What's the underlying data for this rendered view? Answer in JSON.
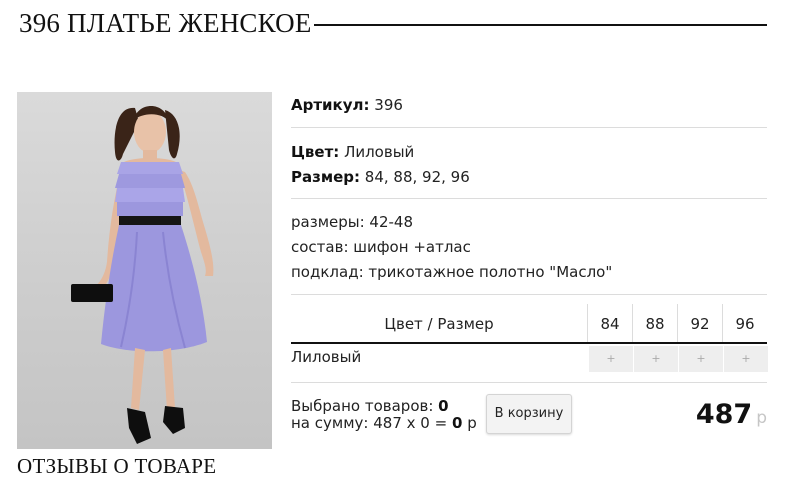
{
  "page_title": "396 ПЛАТЬЕ ЖЕНСКОЕ",
  "product": {
    "article_label": "Артикул:",
    "article_value": "396",
    "color_label": "Цвет:",
    "color_value": "Лиловый",
    "size_label": "Размер:",
    "size_value": "84, 88, 92, 96",
    "description": [
      "размеры: 42-48",
      "состав: шифон +атлас",
      "подклад: трикотажное полотно \"Масло\""
    ]
  },
  "size_grid": {
    "header_label": "Цвет / Размер",
    "sizes": [
      "84",
      "88",
      "92",
      "96"
    ],
    "rows": [
      {
        "color": "Лиловый",
        "cells": [
          "+",
          "+",
          "+",
          "+"
        ]
      }
    ]
  },
  "summary": {
    "selected_label": "Выбрано товаров:",
    "selected_count": "0",
    "sum_label": "на сумму:",
    "sum_expression": "487 x 0 =",
    "sum_total": "0",
    "sum_currency": "р",
    "cart_button": "В корзину",
    "price": "487",
    "price_currency": "р"
  },
  "reviews_heading": "ОТЗЫВЫ О ТОВАРЕ",
  "colors": {
    "dress": "#9c97de",
    "accent_line": "#111111"
  }
}
